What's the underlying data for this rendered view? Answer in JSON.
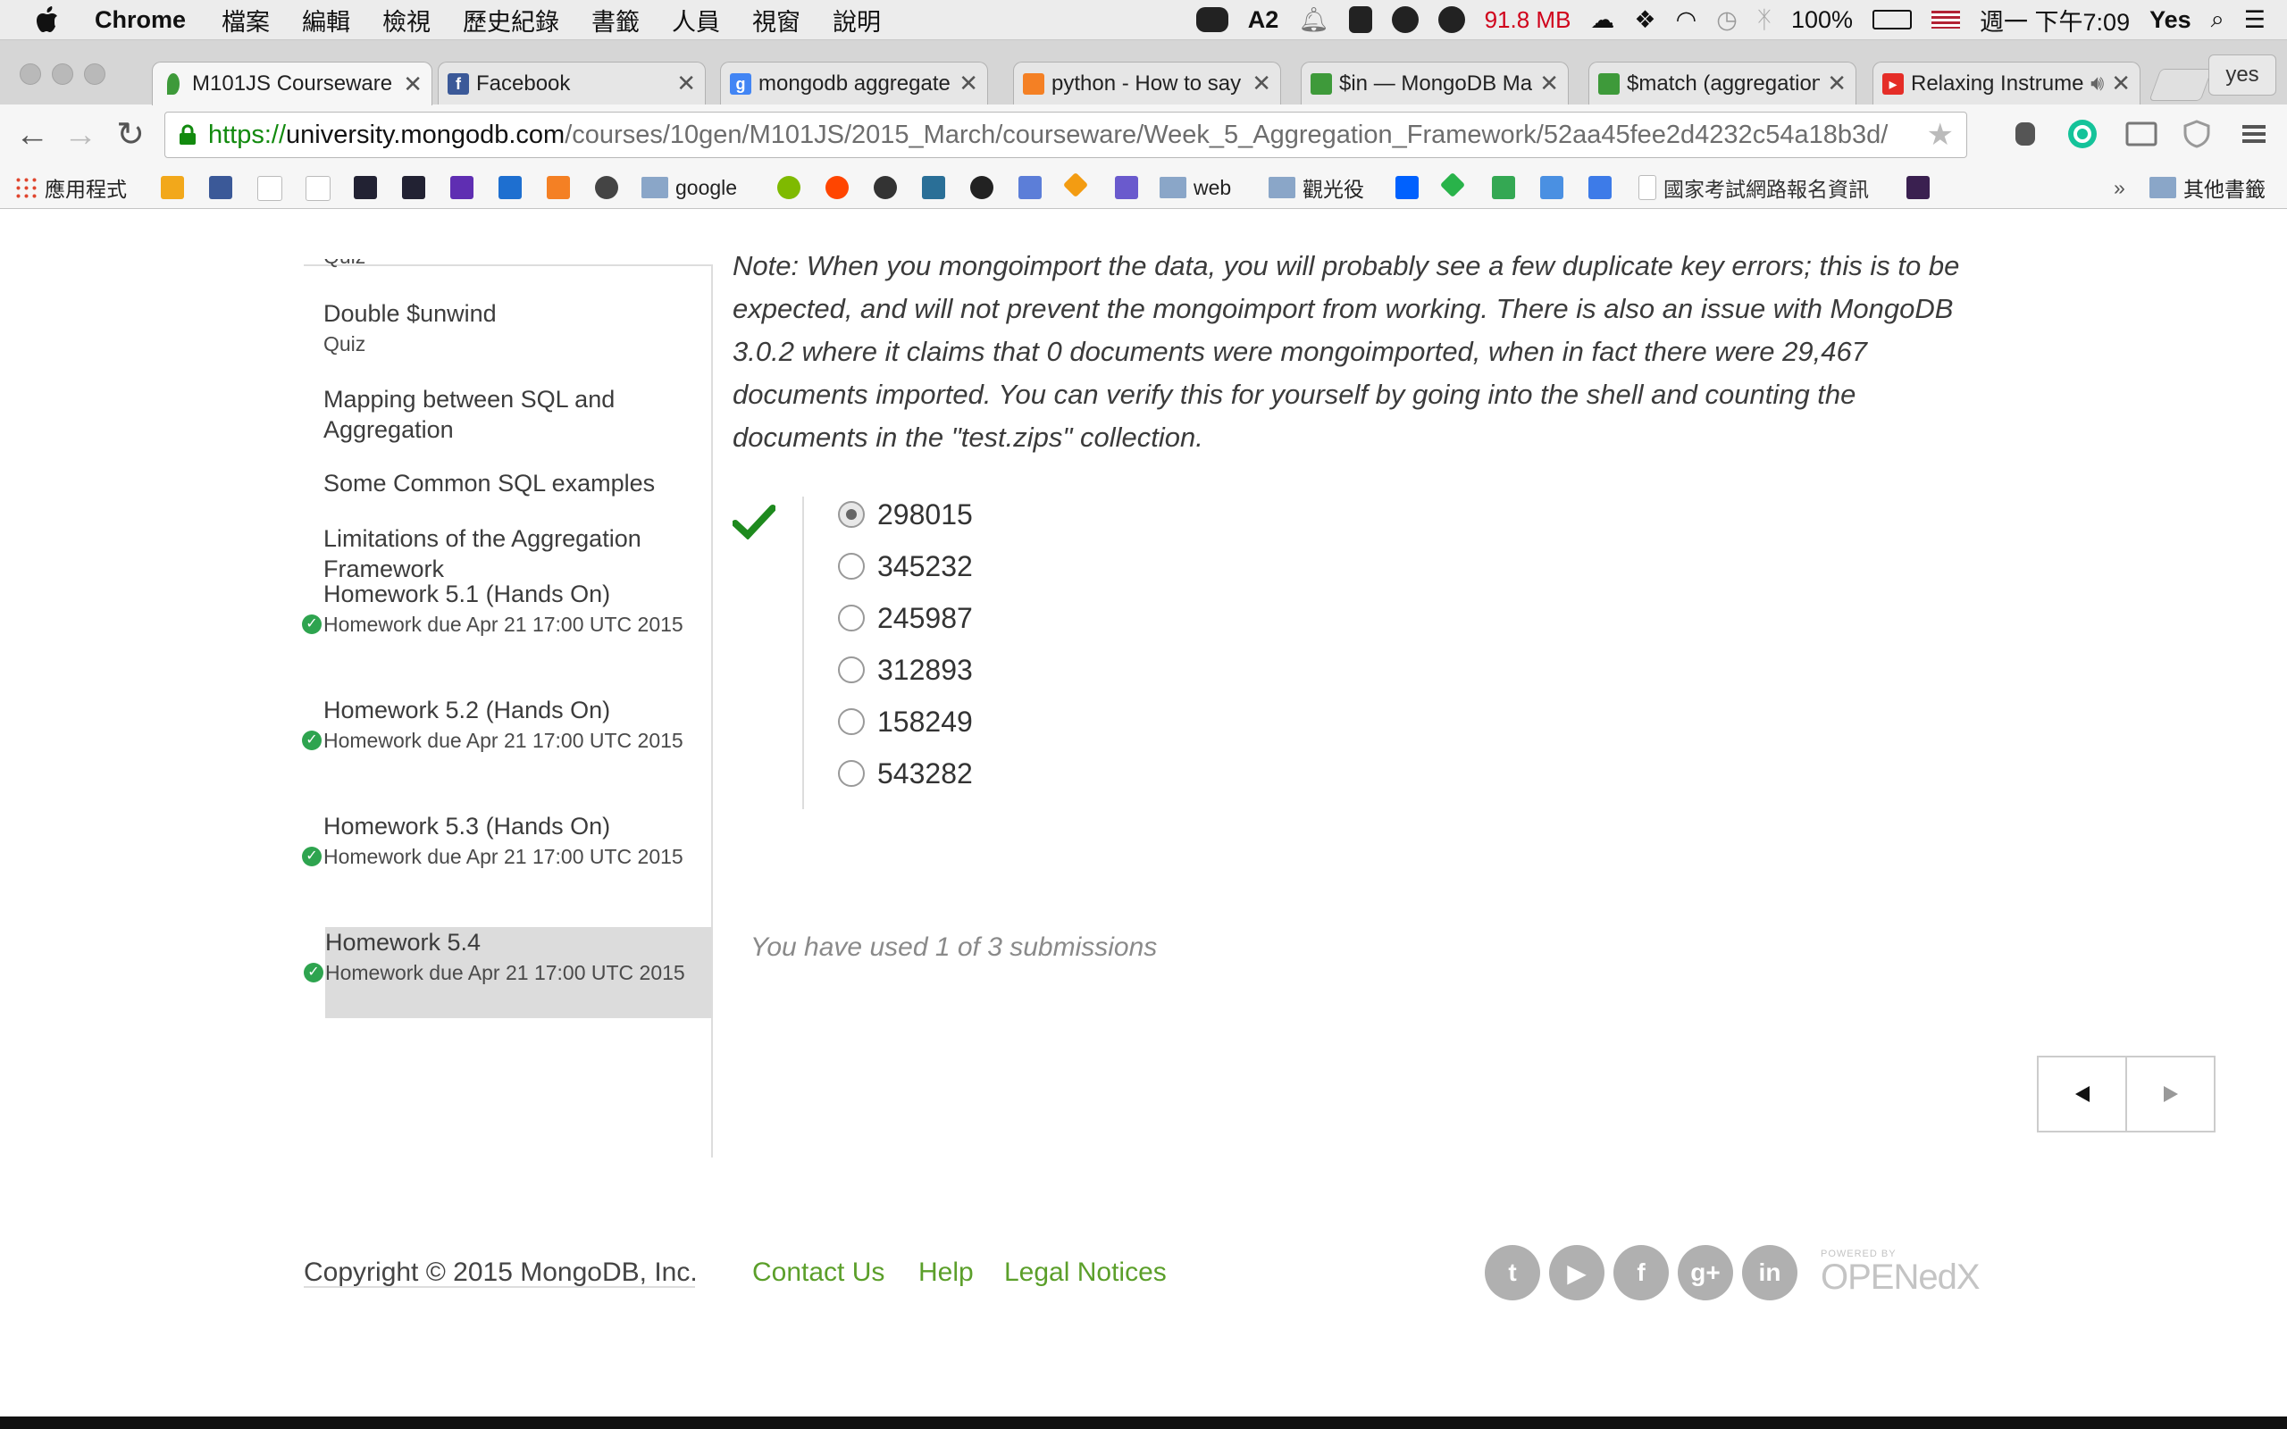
{
  "menubar": {
    "app_name": "Chrome",
    "menus": [
      "檔案",
      "編輯",
      "檢視",
      "歷史紀錄",
      "書籤",
      "人員",
      "視窗",
      "說明"
    ],
    "status": {
      "adobe_count": "2",
      "memory": "91.8 MB",
      "battery": "100%",
      "datetime": "週一 下午7:09",
      "user": "Yes"
    }
  },
  "tabs": [
    {
      "title": "M101JS Courseware",
      "favicon": "mongodb-leaf-icon",
      "color": "#3e9a3a",
      "active": true
    },
    {
      "title": "Facebook",
      "favicon": "facebook-icon",
      "color": "#3b5998"
    },
    {
      "title": "mongodb aggregate",
      "favicon": "google-icon",
      "color": "#4285f4"
    },
    {
      "title": "python - How to say",
      "favicon": "stackoverflow-icon",
      "color": "#f48024"
    },
    {
      "title": "$in — MongoDB Ma",
      "favicon": "mongodb-leaf-icon",
      "color": "#3e9a3a"
    },
    {
      "title": "$match (aggregation",
      "favicon": "mongodb-leaf-icon",
      "color": "#3e9a3a"
    },
    {
      "title": "Relaxing Instrume",
      "favicon": "youtube-icon",
      "color": "#e52d27"
    }
  ],
  "profile_button": "yes",
  "url": {
    "scheme": "https://",
    "host": "university.mongodb.com",
    "path": "/courses/10gen/M101JS/2015_March/courseware/Week_5_Aggregation_Framework/52aa45fee2d4232c54a18b3d/"
  },
  "bookmarks": [
    {
      "label": "應用程式",
      "icon": "apps-grid-icon"
    },
    {
      "label": "google",
      "icon": "folder-icon"
    },
    {
      "label": "web",
      "icon": "folder-icon"
    },
    {
      "label": "觀光役",
      "icon": "folder-icon"
    },
    {
      "label": "國家考試網路報名資訊",
      "icon": "page-icon"
    },
    {
      "label": "其他書籤",
      "icon": "folder-icon"
    }
  ],
  "sidebar": {
    "cut_item": "Quiz",
    "items": [
      {
        "title": "Double $unwind",
        "sub": "Quiz"
      },
      {
        "title": "Mapping between SQL and Aggregation",
        "sub": ""
      },
      {
        "title": "Some Common SQL examples",
        "sub": ""
      },
      {
        "title": "Limitations of the Aggregation Framework",
        "sub": ""
      },
      {
        "title": "Homework 5.1 (Hands On)",
        "sub": "Homework due Apr 21 17:00 UTC 2015",
        "done": true
      },
      {
        "title": "Homework 5.2 (Hands On)",
        "sub": "Homework due Apr 21 17:00 UTC 2015",
        "done": true
      },
      {
        "title": "Homework 5.3 (Hands On)",
        "sub": "Homework due Apr 21 17:00 UTC 2015",
        "done": true
      },
      {
        "title": "Homework 5.4",
        "sub": "Homework due Apr 21 17:00 UTC 2015",
        "done": true,
        "active": true
      }
    ]
  },
  "problem": {
    "note": "Note: When you mongoimport the data, you will probably see a few duplicate key errors; this is to be expected, and will not prevent the mongoimport from working. There is also an issue with MongoDB 3.0.2 where it claims that 0 documents were mongoimported, when in fact there were 29,467 documents imported. You can verify this for yourself by going into the shell and counting the documents in the \"test.zips\" collection.",
    "choices": [
      "298015",
      "345232",
      "245987",
      "312893",
      "158249",
      "543282"
    ],
    "selected_index": 0,
    "status": "correct",
    "submissions": "You have used 1 of 3 submissions"
  },
  "footer": {
    "copyright": "Copyright © 2015 MongoDB, Inc.",
    "links": [
      "Contact Us",
      "Help",
      "Legal Notices"
    ],
    "social": [
      "twitter-icon",
      "youtube-icon",
      "facebook-icon",
      "google-plus-icon",
      "linkedin-icon"
    ],
    "powered_by": "POWERED BY",
    "brand": "OPENedX"
  },
  "colors": {
    "accent_green": "#5b9f2a",
    "check_green": "#1e8a1e",
    "url_green": "#128a0e",
    "memory_red": "#d0021b"
  }
}
